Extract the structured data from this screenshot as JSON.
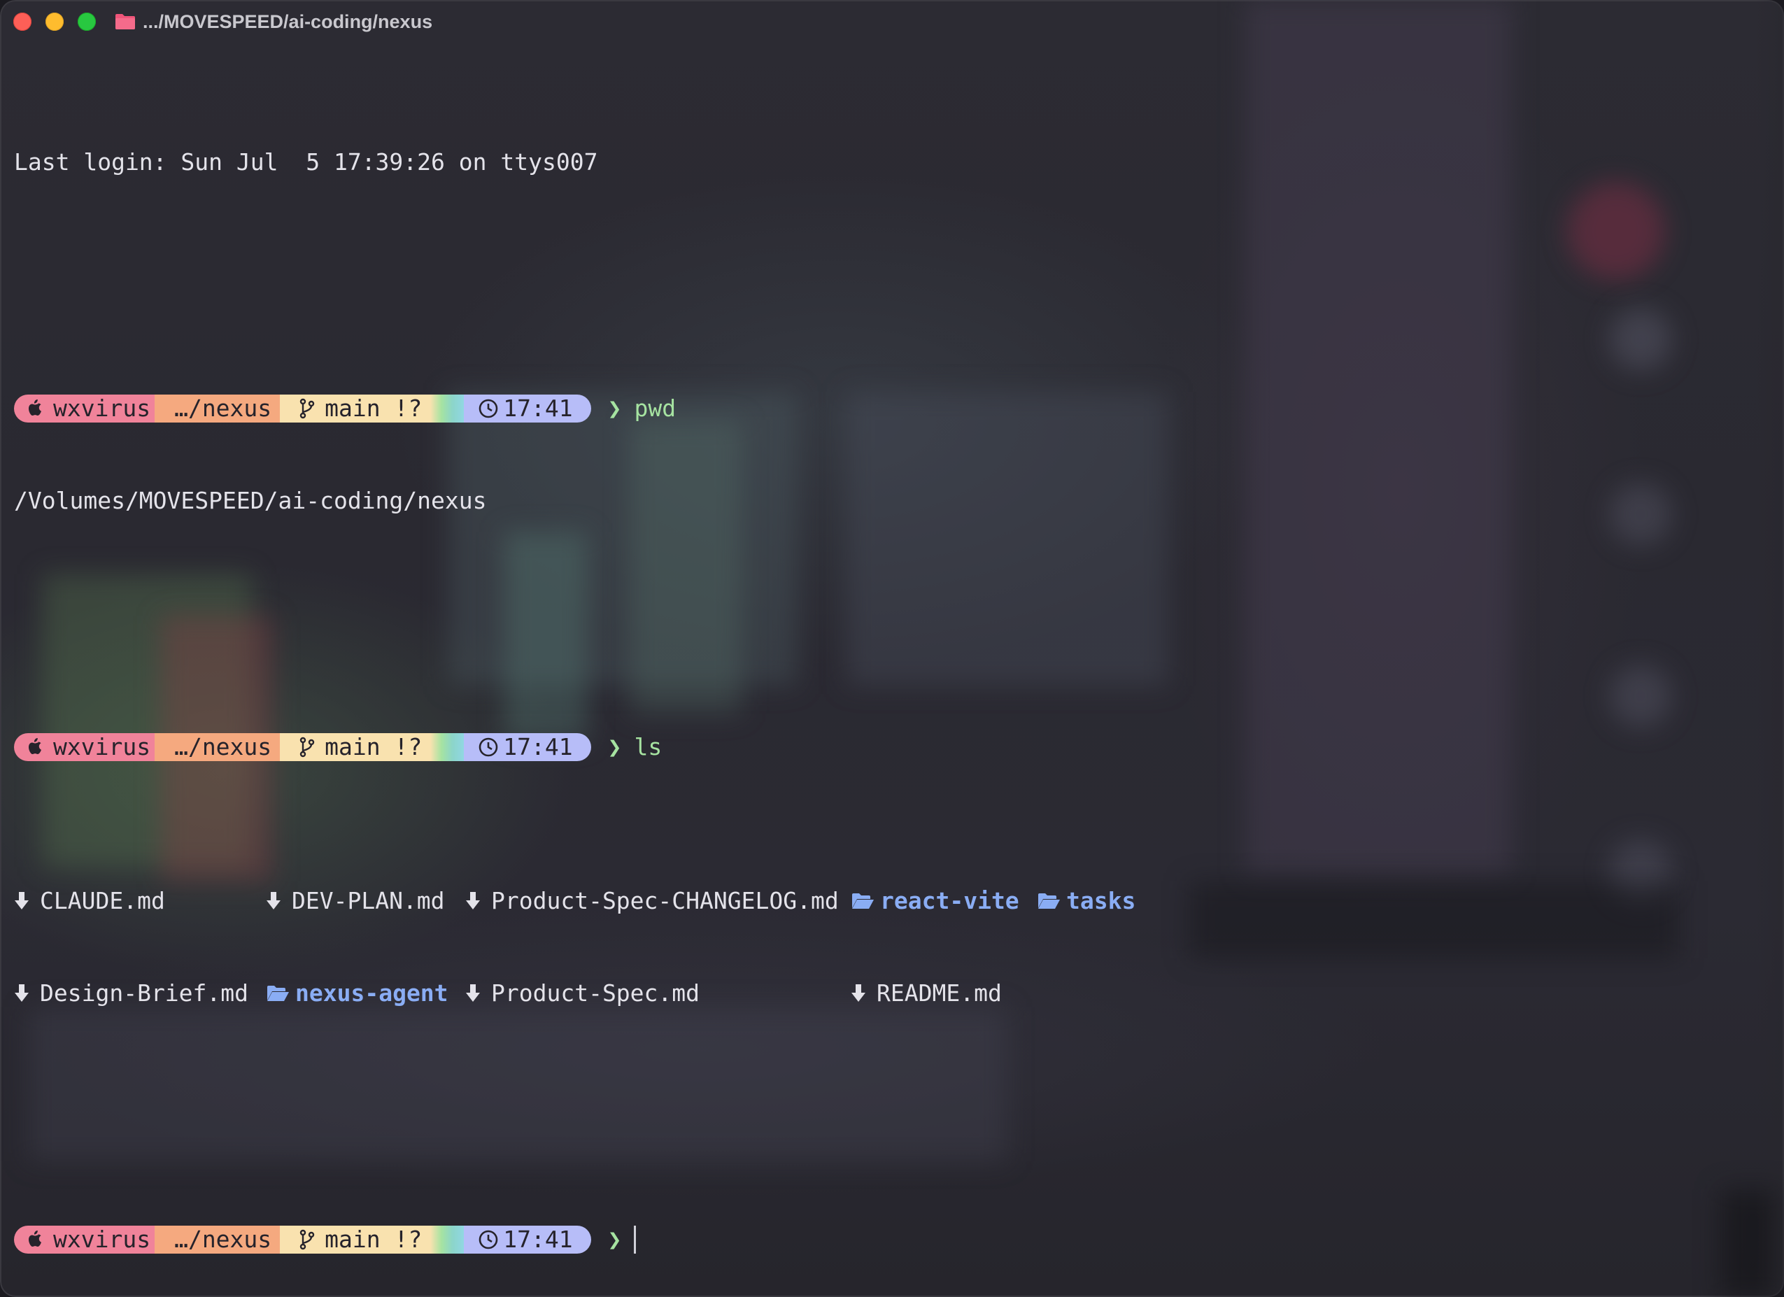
{
  "window": {
    "title": ".../MOVESPEED/ai-coding/nexus",
    "folder_icon": "folder-icon",
    "colors": {
      "close": "#fe5f57",
      "minimize": "#febc2e",
      "zoom": "#28c840"
    }
  },
  "terminal": {
    "last_login": "Last login: Sun Jul  5 17:39:26 on ttys007",
    "prompt": {
      "os_icon": "apple-icon",
      "user": "wxvirus",
      "dir": "…/nexus",
      "git_icon": "git-branch-icon",
      "git": "main !?",
      "time_icon": "clock-icon",
      "time": "17:41",
      "symbol": "❯"
    },
    "commands": [
      {
        "cmd": "pwd",
        "output": "/Volumes/MOVESPEED/ai-coding/nexus"
      },
      {
        "cmd": "ls"
      }
    ],
    "ls": {
      "row1": [
        "CLAUDE.md",
        "DEV-PLAN.md",
        "Product-Spec-CHANGELOG.md",
        "react-vite",
        "tasks"
      ],
      "row2": [
        "Design-Brief.md",
        "nexus-agent",
        "Product-Spec.md",
        "README.md"
      ]
    },
    "colors": {
      "user": "#f0839a",
      "dir": "#f5a97f",
      "git": "#f9e2af",
      "time": "#b7bdf8",
      "prompt_symbol": "#a6e3a1",
      "folder": "#8aadf4"
    }
  }
}
